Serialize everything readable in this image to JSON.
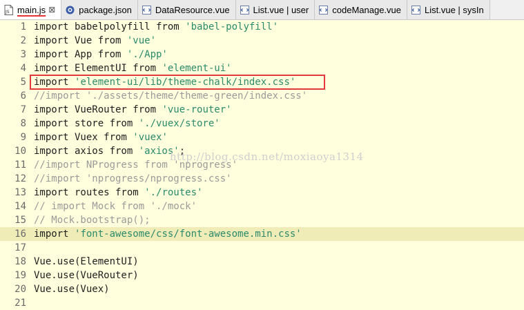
{
  "tabs": [
    {
      "label": "main.js",
      "icon": "js-file-icon",
      "active": true
    },
    {
      "label": "package.json",
      "icon": "json-file-icon",
      "active": false
    },
    {
      "label": "DataResource.vue",
      "icon": "vue-file-icon",
      "active": false
    },
    {
      "label": "List.vue | user",
      "icon": "vue-file-icon",
      "active": false
    },
    {
      "label": "codeManage.vue",
      "icon": "vue-file-icon",
      "active": false
    },
    {
      "label": "List.vue | sysIn",
      "icon": "vue-file-icon",
      "active": false
    }
  ],
  "close_glyph": "⊠",
  "watermark": "http://blog.csdn.net/moxiaoya1314",
  "colors": {
    "background": "#fffedd",
    "highlight": "#f0ecb8",
    "string": "#2b8a6a",
    "comment": "#9a9a9a",
    "box": "#e23a3a"
  },
  "lines": [
    {
      "n": "1",
      "parts": [
        {
          "t": "import babelpolyfill from ",
          "c": "kw"
        },
        {
          "t": "'babel-polyfill'",
          "c": "str"
        }
      ]
    },
    {
      "n": "2",
      "parts": [
        {
          "t": "import Vue from ",
          "c": "kw"
        },
        {
          "t": "'vue'",
          "c": "str"
        }
      ]
    },
    {
      "n": "3",
      "parts": [
        {
          "t": "import App from ",
          "c": "kw"
        },
        {
          "t": "'./App'",
          "c": "str"
        }
      ]
    },
    {
      "n": "4",
      "parts": [
        {
          "t": "import ElementUI from ",
          "c": "kw"
        },
        {
          "t": "'element-ui'",
          "c": "str"
        }
      ]
    },
    {
      "n": "5",
      "parts": [
        {
          "t": "import ",
          "c": "kw"
        },
        {
          "t": "'element-ui/lib/theme-chalk/index.css'",
          "c": "str"
        }
      ]
    },
    {
      "n": "6",
      "parts": [
        {
          "t": "//import './assets/theme/theme-green/index.css'",
          "c": "cmt"
        }
      ]
    },
    {
      "n": "7",
      "parts": [
        {
          "t": "import VueRouter from ",
          "c": "kw"
        },
        {
          "t": "'vue-router'",
          "c": "str"
        }
      ]
    },
    {
      "n": "8",
      "parts": [
        {
          "t": "import store from ",
          "c": "kw"
        },
        {
          "t": "'./vuex/store'",
          "c": "str"
        }
      ]
    },
    {
      "n": "9",
      "parts": [
        {
          "t": "import Vuex from ",
          "c": "kw"
        },
        {
          "t": "'vuex'",
          "c": "str"
        }
      ]
    },
    {
      "n": "10",
      "parts": [
        {
          "t": "import axios from ",
          "c": "kw"
        },
        {
          "t": "'axios'",
          "c": "str"
        },
        {
          "t": ";",
          "c": "kw"
        }
      ]
    },
    {
      "n": "11",
      "parts": [
        {
          "t": "//import NProgress from 'nprogress'",
          "c": "cmt"
        }
      ]
    },
    {
      "n": "12",
      "parts": [
        {
          "t": "//import 'nprogress/nprogress.css'",
          "c": "cmt"
        }
      ]
    },
    {
      "n": "13",
      "parts": [
        {
          "t": "import routes from ",
          "c": "kw"
        },
        {
          "t": "'./routes'",
          "c": "str"
        }
      ]
    },
    {
      "n": "14",
      "parts": [
        {
          "t": "// import Mock from './mock'",
          "c": "cmt"
        }
      ]
    },
    {
      "n": "15",
      "parts": [
        {
          "t": "// Mock.bootstrap();",
          "c": "cmt"
        }
      ]
    },
    {
      "n": "16",
      "parts": [
        {
          "t": "import ",
          "c": "kw"
        },
        {
          "t": "'font-awesome/css/font-awesome.min.css'",
          "c": "str"
        }
      ],
      "highlight": true
    },
    {
      "n": "17",
      "parts": []
    },
    {
      "n": "18",
      "parts": [
        {
          "t": "Vue.use(ElementUI)",
          "c": "kw"
        }
      ]
    },
    {
      "n": "19",
      "parts": [
        {
          "t": "Vue.use(VueRouter)",
          "c": "kw"
        }
      ]
    },
    {
      "n": "20",
      "parts": [
        {
          "t": "Vue.use(Vuex)",
          "c": "kw"
        }
      ]
    },
    {
      "n": "21",
      "parts": []
    }
  ]
}
